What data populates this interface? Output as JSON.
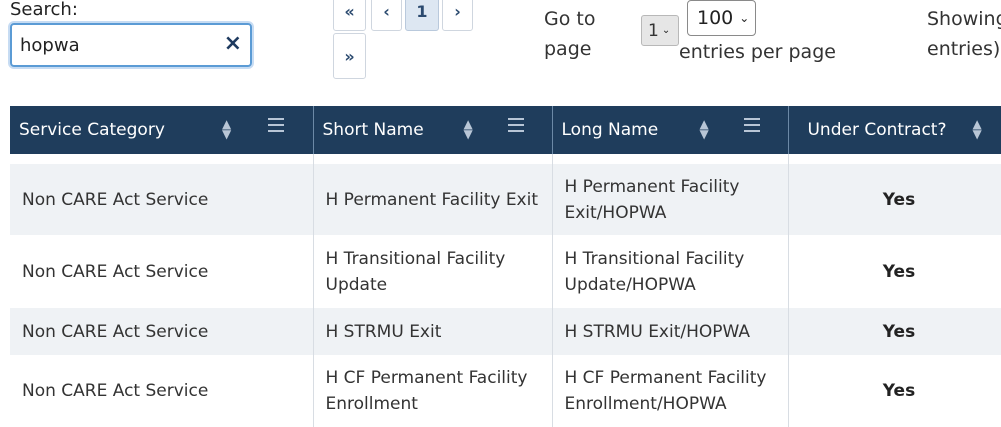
{
  "search": {
    "label": "Search:",
    "value": "hopwa",
    "clear_icon": "×"
  },
  "pagination": {
    "first": "«",
    "prev": "‹",
    "current": "1",
    "next": "›",
    "last": "»"
  },
  "goto": {
    "label": "Go to page",
    "selected": "1"
  },
  "per_page": {
    "selected": "100",
    "label": "entries per page"
  },
  "showing": {
    "text": "Showing\nentries)"
  },
  "table": {
    "headers": [
      "Service Category",
      "Short Name",
      "Long Name",
      "Under Contract?"
    ],
    "rows": [
      [
        "Non CARE Act Service",
        "H Permanent Facility Exit",
        "H Permanent Facility Exit/HOPWA",
        "Yes"
      ],
      [
        "Non CARE Act Service",
        "H Transitional Facility Update",
        "H Transitional Facility Update/HOPWA",
        "Yes"
      ],
      [
        "Non CARE Act Service",
        "H STRMU Exit",
        "H STRMU Exit/HOPWA",
        "Yes"
      ],
      [
        "Non CARE Act Service",
        "H CF Permanent Facility Enrollment",
        "H CF Permanent Facility Enrollment/HOPWA",
        "Yes"
      ]
    ]
  },
  "colors": {
    "header_bg": "#1f3d5c",
    "odd_row_bg": "#eff2f5",
    "focus_border": "#5b9bd5"
  }
}
